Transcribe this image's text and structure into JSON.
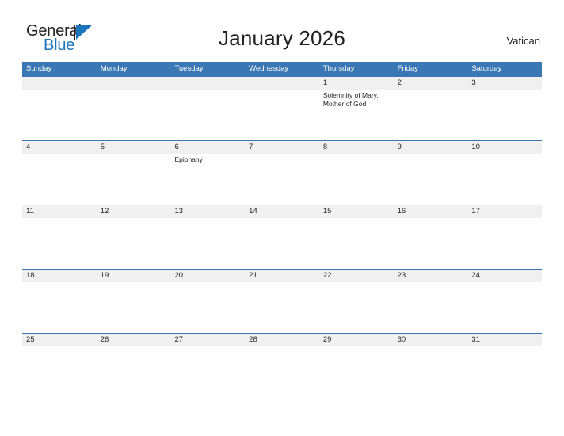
{
  "brand": {
    "name_dark": "General",
    "name_blue": "Blue",
    "logo_icon": "triangle-flag-icon",
    "accent_color": "#1b75bb"
  },
  "header": {
    "title": "January 2026",
    "region": "Vatican"
  },
  "calendar": {
    "header_color": "#3a78b5",
    "band_color": "#f0f0f0",
    "weekdays": [
      "Sunday",
      "Monday",
      "Tuesday",
      "Wednesday",
      "Thursday",
      "Friday",
      "Saturday"
    ],
    "weeks": [
      [
        {
          "day": "",
          "event": ""
        },
        {
          "day": "",
          "event": ""
        },
        {
          "day": "",
          "event": ""
        },
        {
          "day": "",
          "event": ""
        },
        {
          "day": "1",
          "event": "Solemnity of Mary, Mother of God"
        },
        {
          "day": "2",
          "event": ""
        },
        {
          "day": "3",
          "event": ""
        }
      ],
      [
        {
          "day": "4",
          "event": ""
        },
        {
          "day": "5",
          "event": ""
        },
        {
          "day": "6",
          "event": "Epiphany"
        },
        {
          "day": "7",
          "event": ""
        },
        {
          "day": "8",
          "event": ""
        },
        {
          "day": "9",
          "event": ""
        },
        {
          "day": "10",
          "event": ""
        }
      ],
      [
        {
          "day": "11",
          "event": ""
        },
        {
          "day": "12",
          "event": ""
        },
        {
          "day": "13",
          "event": ""
        },
        {
          "day": "14",
          "event": ""
        },
        {
          "day": "15",
          "event": ""
        },
        {
          "day": "16",
          "event": ""
        },
        {
          "day": "17",
          "event": ""
        }
      ],
      [
        {
          "day": "18",
          "event": ""
        },
        {
          "day": "19",
          "event": ""
        },
        {
          "day": "20",
          "event": ""
        },
        {
          "day": "21",
          "event": ""
        },
        {
          "day": "22",
          "event": ""
        },
        {
          "day": "23",
          "event": ""
        },
        {
          "day": "24",
          "event": ""
        }
      ],
      [
        {
          "day": "25",
          "event": ""
        },
        {
          "day": "26",
          "event": ""
        },
        {
          "day": "27",
          "event": ""
        },
        {
          "day": "28",
          "event": ""
        },
        {
          "day": "29",
          "event": ""
        },
        {
          "day": "30",
          "event": ""
        },
        {
          "day": "31",
          "event": ""
        }
      ]
    ]
  }
}
